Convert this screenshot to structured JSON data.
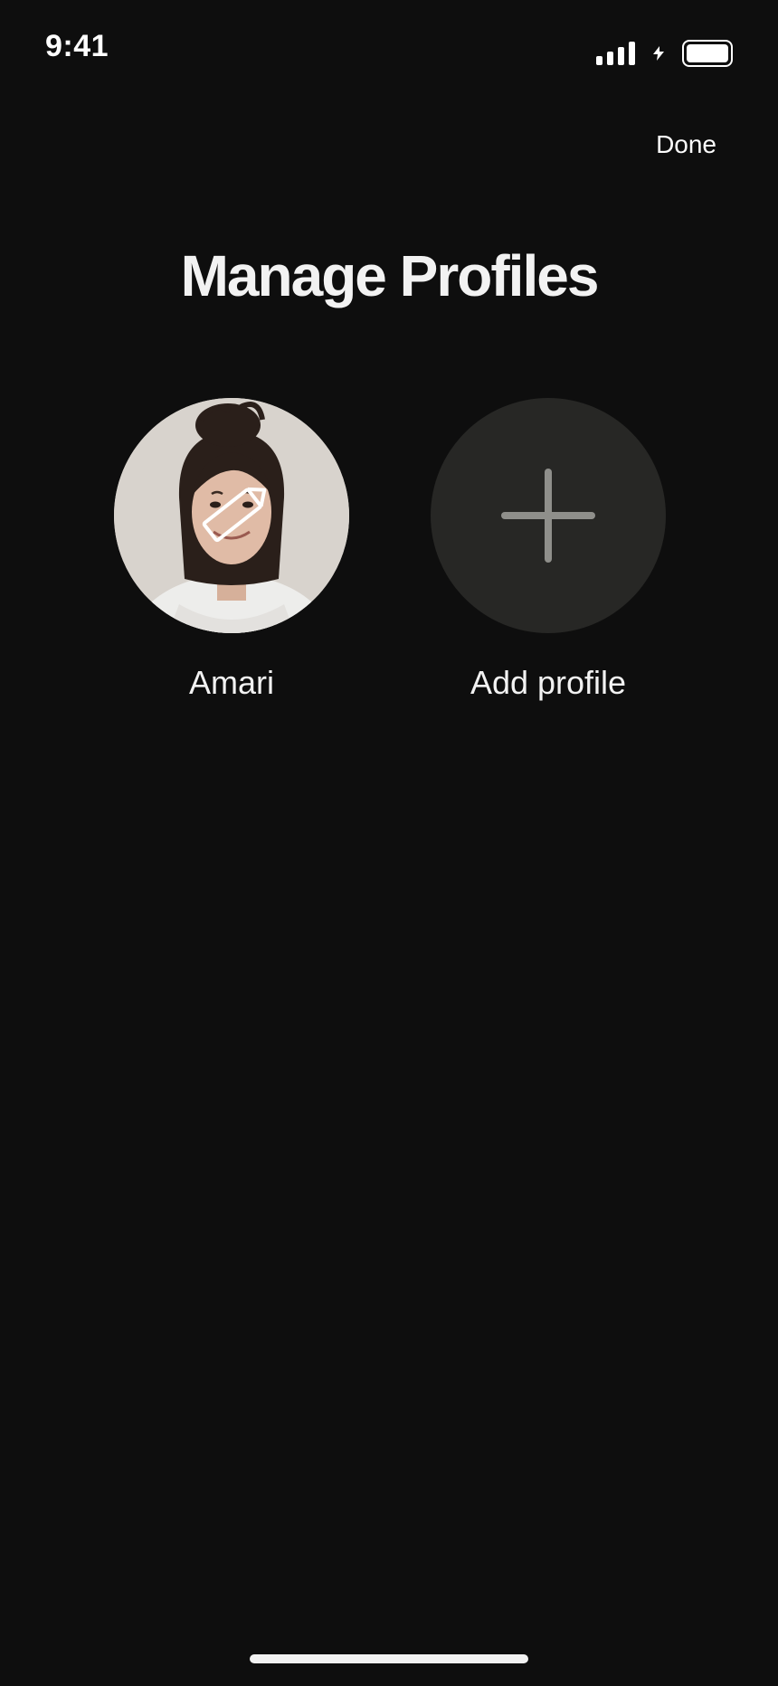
{
  "status_bar": {
    "time": "9:41",
    "icons": [
      "signal-icon",
      "lightning-icon",
      "battery-icon"
    ]
  },
  "header": {
    "done_label": "Done"
  },
  "title": "Manage Profiles",
  "profiles": [
    {
      "name": "Amari",
      "avatar": "profile-photo",
      "overlay_icon": "pencil-icon"
    }
  ],
  "add_profile": {
    "label": "Add profile",
    "icon": "plus-icon"
  },
  "colors": {
    "background": "#0e0e0e",
    "text": "#f2f2f2",
    "add_circle": "#272725",
    "plus": "#8f8f8b"
  }
}
